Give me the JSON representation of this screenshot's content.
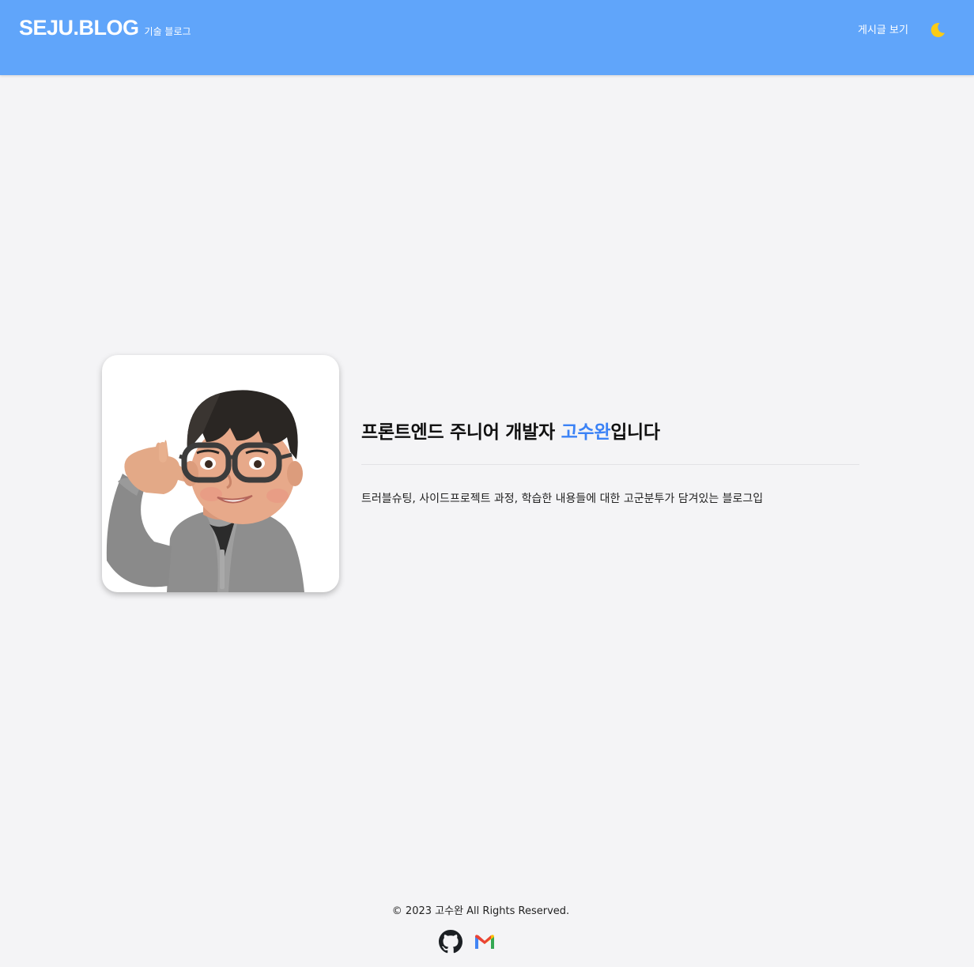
{
  "header": {
    "brand_title": "SEJU.BLOG",
    "brand_subtitle": "기술 블로그",
    "nav_posts": "게시글 보기",
    "theme_icon": "moon-icon"
  },
  "hero": {
    "avatar_icon": "memoji-avatar",
    "headline_prefix": "프론트엔드 주니어 개발자 ",
    "headline_name": "고수완",
    "headline_suffix": "입니다",
    "description": "트러블슈팅, 사이드프로젝트 과정, 학습한 내용들에 대한 고군분투가 담겨있는 블로그입"
  },
  "footer": {
    "copyright": "© 2023 고수완 All Rights Reserved.",
    "social_icons": [
      "github-icon",
      "gmail-icon"
    ]
  },
  "colors": {
    "header_bg": "#60a5fa",
    "accent": "#3b82f6",
    "page_bg": "#f4f4f6",
    "moon": "#facc15"
  }
}
